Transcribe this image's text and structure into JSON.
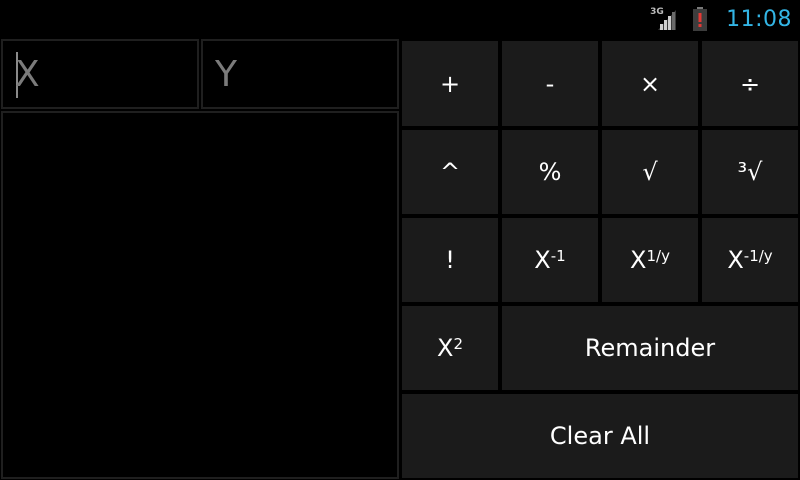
{
  "status_bar": {
    "network_type": "3G",
    "time": "11:08",
    "colors": {
      "clock": "#33b5e5",
      "battery_alert": "#d32f2f"
    }
  },
  "inputs": {
    "x_placeholder": "X",
    "y_placeholder": "Y"
  },
  "keys": {
    "add": "+",
    "subtract": "-",
    "multiply": "×",
    "divide": "÷",
    "power": "^",
    "percent": "%",
    "square_root": "√",
    "cube_root": "³√",
    "factorial": "!",
    "inverse_base": "X",
    "inverse_exp": "-1",
    "yth_root_base": "X",
    "yth_root_exp": "1/y",
    "inv_yth_root_base": "X",
    "inv_yth_root_exp": "-1/y",
    "square_base": "X",
    "square_exp": "2",
    "remainder": "Remainder",
    "clear_all": "Clear All"
  }
}
